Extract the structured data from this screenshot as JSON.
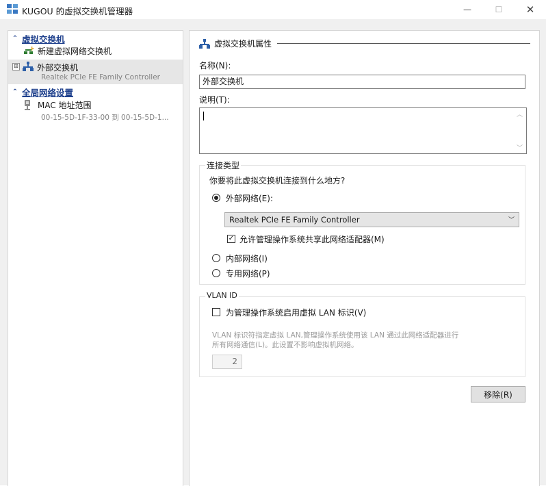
{
  "window": {
    "title": "KUGOU 的虚拟交换机管理器",
    "controls": {
      "minimize": "—",
      "maximize": "☐",
      "close": "✕"
    }
  },
  "sidebar": {
    "section_virtual_switches": {
      "label": "虚拟交换机",
      "chevron": "⌃"
    },
    "new_switch": {
      "label": "新建虚拟网络交换机"
    },
    "external_switch": {
      "label": "外部交换机",
      "sublabel": "Realtek PCIe FE Family Controller",
      "expand": "⊞"
    },
    "section_global": {
      "label": "全局网络设置",
      "chevron": "⌃"
    },
    "mac_range": {
      "label": "MAC 地址范围",
      "sublabel": "00-15-5D-1F-33-00 到 00-15-5D-1..."
    }
  },
  "properties": {
    "header": "虚拟交换机属性",
    "name_label": "名称(N):",
    "name_value": "外部交换机",
    "notes_label": "说明(T):",
    "notes_value": "",
    "connection_type": {
      "title": "连接类型",
      "question": "你要将此虚拟交换机连接到什么地方?",
      "external": {
        "label": "外部网络(E):",
        "selected": true
      },
      "adapter": "Realtek PCIe FE Family Controller",
      "allow_share": {
        "label": "允许管理操作系统共享此网络适配器(M)",
        "checked": true
      },
      "internal": {
        "label": "内部网络(I)",
        "selected": false
      },
      "private": {
        "label": "专用网络(P)",
        "selected": false
      }
    },
    "vlan": {
      "title": "VLAN ID",
      "enable": {
        "label": "为管理操作系统启用虚拟 LAN 标识(V)",
        "checked": false
      },
      "description_line1": "VLAN 标识符指定虚拟 LAN,管理操作系统使用该 LAN 通过此网络适配器进行",
      "description_line2": "所有网络通信(L)。此设置不影响虚拟机网络。",
      "id_value": "2"
    },
    "remove_button": "移除(R)"
  },
  "colors": {
    "link_blue": "#1d3f8c",
    "panel_bg": "#f0f0f0",
    "selected_row": "#e6e6e6"
  }
}
